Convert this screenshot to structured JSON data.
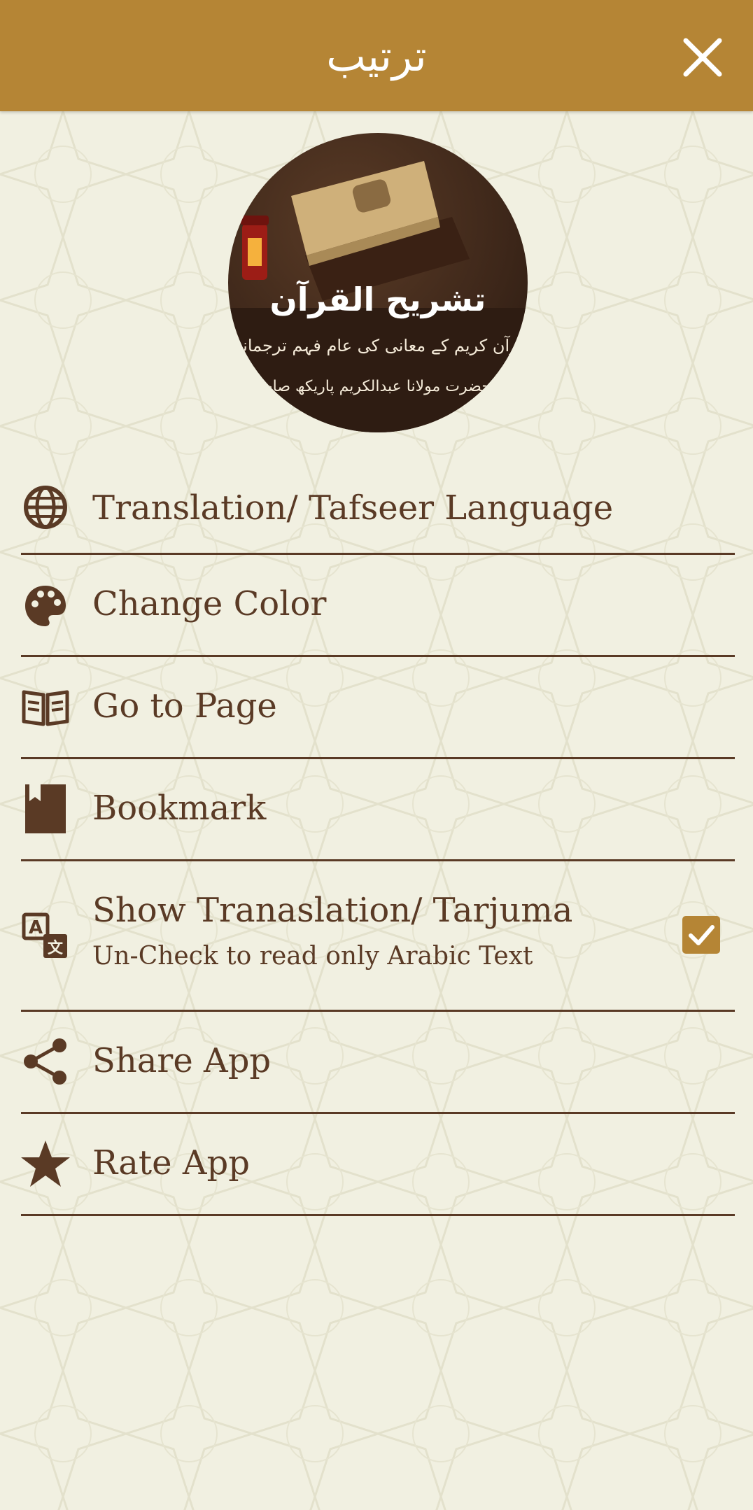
{
  "header": {
    "title": "ترتیب"
  },
  "logo": {
    "title": "تشریح القرآن",
    "subtitle": "قرآن کریم کے معانی کی عام فہم ترجمانی",
    "author": "از حضرت مولانا عبدالکریم پاریکھ صاحب"
  },
  "menu": {
    "translation_language": "Translation/ Tafseer Language",
    "change_color": "Change Color",
    "go_to_page": "Go to Page",
    "bookmark": "Bookmark",
    "show_translation": "Show Tranaslation/ Tarjuma",
    "show_translation_sub": "Un-Check to read only Arabic Text",
    "show_translation_checked": true,
    "share_app": "Share App",
    "rate_app": "Rate App"
  },
  "icons": {
    "close": "close-icon",
    "translation_language": "globe-icon",
    "change_color": "palette-icon",
    "go_to_page": "open-book-icon",
    "bookmark": "bookmark-icon",
    "show_translation": "translate-icon",
    "share_app": "share-icon",
    "rate_app": "star-icon",
    "checkbox": "checkmark-icon"
  },
  "colors": {
    "header_bg": "#b58535",
    "page_bg": "#f1f0e1",
    "text": "#5a3a25",
    "divider": "#5a3a25",
    "checkbox": "#b58535"
  }
}
